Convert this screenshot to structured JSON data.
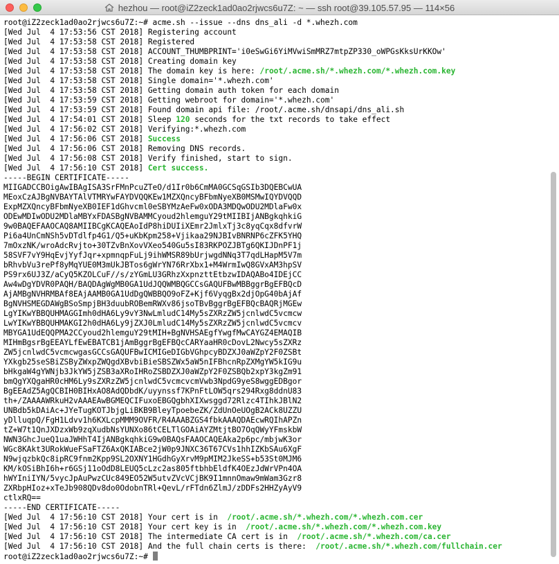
{
  "window": {
    "title": "hezhou — root@iZ2zeck1ad0ao2rjwcs6u7Z: ~ — ssh root@39.105.57.95 — 114×56",
    "home_icon": "home-icon"
  },
  "colors": {
    "highlight": "#2ab532",
    "cursor": "#7f7f7f",
    "text": "#000000"
  },
  "terminal": {
    "prompt_cmd": "root@iZ2zeck1ad0ao2rjwcs6u7Z:~# acme.sh --issue --dns dns_ali -d *.whezh.com",
    "log1": [
      {
        "time": "[Wed Jul  4 17:53:56 CST 2018] ",
        "msg": "Registering account",
        "hl": ""
      },
      {
        "time": "[Wed Jul  4 17:53:58 CST 2018] ",
        "msg": "Registered",
        "hl": ""
      },
      {
        "time": "[Wed Jul  4 17:53:58 CST 2018] ",
        "msg": "ACCOUNT_THUMBPRINT='i0eSwGi6YiMVwiSmMRZ7mtpZP330_oWPGsKksUrKKOw'",
        "hl": ""
      },
      {
        "time": "[Wed Jul  4 17:53:58 CST 2018] ",
        "msg": "Creating domain key",
        "hl": ""
      },
      {
        "time": "[Wed Jul  4 17:53:58 CST 2018] ",
        "msg": "The domain key is here: ",
        "hl": "/root/.acme.sh/*.whezh.com/*.whezh.com.key"
      },
      {
        "time": "[Wed Jul  4 17:53:58 CST 2018] ",
        "msg": "Single domain='*.whezh.com'",
        "hl": ""
      },
      {
        "time": "[Wed Jul  4 17:53:58 CST 2018] ",
        "msg": "Getting domain auth token for each domain",
        "hl": ""
      },
      {
        "time": "[Wed Jul  4 17:53:59 CST 2018] ",
        "msg": "Getting webroot for domain='*.whezh.com'",
        "hl": ""
      },
      {
        "time": "[Wed Jul  4 17:53:59 CST 2018] ",
        "msg": "Found domain api file: /root/.acme.sh/dnsapi/dns_ali.sh",
        "hl": ""
      }
    ],
    "sleep_line": {
      "time": "[Wed Jul  4 17:54:01 CST 2018] ",
      "pre": "Sleep ",
      "hl": "120",
      "post": " seconds for the txt records to take effect"
    },
    "log2": [
      {
        "time": "[Wed Jul  4 17:56:02 CST 2018] ",
        "msg": "Verifying:*.whezh.com",
        "hl": ""
      },
      {
        "time": "[Wed Jul  4 17:56:06 CST 2018] ",
        "msg": "",
        "hl": "Success"
      },
      {
        "time": "[Wed Jul  4 17:56:06 CST 2018] ",
        "msg": "Removing DNS records.",
        "hl": ""
      },
      {
        "time": "[Wed Jul  4 17:56:08 CST 2018] ",
        "msg": "Verify finished, start to sign.",
        "hl": ""
      },
      {
        "time": "[Wed Jul  4 17:56:10 CST 2018] ",
        "msg": "",
        "hl": "Cert success."
      }
    ],
    "certificate": [
      "-----BEGIN CERTIFICATE-----",
      "MIIGADCCBOigAwIBAgISA3SrFMnPcuZTeO/d1Ir0b6CmMA0GCSqGSIb3DQEBCwUA",
      "MEoxCzAJBgNVBAYTAlVTMRYwFAYDVQQKEw1MZXQncyBFbmNyeXB0MSMwIQYDVQQD",
      "ExpMZXQncyBFbmNyeXB0IEF1dGhvcml0eSBYMzAeFw0xODA3MDQwODU2MDlaFw0x",
      "ODEwMDIwODU2MDlaMBYxFDASBgNVBAMMCyoud2hlemguY29tMIIBIjANBgkqhkiG",
      "9w0BAQEFAAOCAQ8AMIIBCgKCAQEAoIdP8hiDUIiXEmr2JmlxTj3c8yqCqx8dfvrW",
      "Pi6a4UnCmNSh5vDTdlfp4G1/Q5+uKbKpm258+Vjikaa29NJBIvBNRNP6cZFK5YHQ",
      "7mOxzNK/wroAdcRvjto+30TZvBnXovVXeo540Gu5sI83RKPOZJBTg6QKIJDnPF1j",
      "58SVF7vY9HqEvjYyfJqr+xpmnqpFuLj9ihWMSR89bUrjwgdNNq3T7qdLHapM5V7m",
      "bRhvbVu3rePf8yMqYUE0M3mUkJBTos6gWrYN76RrXbx1+M4WrmIwQ8GVxAM3hpSV",
      "PS9rx6UJ3Z/aCyQ5KZOLCuF//s/zYGmLU3GRhzXxpnzttEtbzwIDAQABo4IDEjCC",
      "Aw4wDgYDVR0PAQH/BAQDAgWgMB0GA1UdJQQWMBQGCCsGAQUFBwMBBggrBgEFBQcD",
      "AjAMBgNVHRMBAf8EAjAAMB0GA1UdDgQWBBQO9oFZ+Kjf6VyqgBx2djOpG40bAjAf",
      "BgNVHSMEGDAWgBSoSmpjBH3duubROBemRWXv86jsoTBvBggrBgEFBQcBAQRjMGEw",
      "LgYIKwYBBQUHMAGGImh0dHA6Ly9vY3NwLmludC14My5sZXRzZW5jcnlwdC5vcmcw",
      "LwYIKwYBBQUHMAKGI2h0dHA6Ly9jZXJ0LmludC14My5sZXRzZW5jcnlwdC5vcmcv",
      "MBYGA1UdEQQPMA2CCyoud2hlemguY29tMIH+BgNVHSAEgfYwgfMwCAYGZ4EMAQIB",
      "MIHmBgsrBgEEAYLfEwEBATCB1jAmBggrBgEFBQcCARYaaHR0cDovL2Nwcy5sZXRz",
      "ZW5jcnlwdC5vcmcwgasGCCsGAQUFBwICMIGeDIGbVGhpcyBDZXJ0aWZpY2F0ZSBt",
      "YXkgb25seSBiZSByZWxpZWQgdXBvbiBieSBSZWx5aW5nIFBhcnRpZXMgYW5kIG9u",
      "bHkgaW4gYWNjb3JkYW5jZSB3aXRoIHRoZSBDZXJ0aWZpY2F0ZSBQb2xpY3kgZm91",
      "bmQgYXQgaHR0cHM6Ly9sZXRzZW5jcnlwdC5vcmcvcmVwb3NpdG9yeS8wggEDBgor",
      "BgEEAdZ5AgQCBIH0BIHxAO8AdQDbdK/uyynssf7KPnFtLOW5qrs294Rxg8ddnU83",
      "th+/ZAAAAWRkuH2vAAAEAwBGMEQCIFuxoEBGQgbhXIXwsggd72Rlzc4TIhkJBlN2",
      "UNBdb5kDAiAc+JYeTugKOTJbjgLiBKB9BleyTpoebeZK/ZdUnOeUOgB2ACk8UZZU",
      "yDlluqpQ/FgH1Ldvv1h6KXLcpMMM9OVFR/R4AAABZGS4fbkAAAQDAEcwRQIhAPZn",
      "tZ+W7t1QnJXDzxWb9zqXudbNsYUNXo86tCELTlGOAiAYZMtjtBO7OqQWyYFmskbW",
      "NWN3GhcJueQ1uaJWHhT4IjANBgkqhkiG9w0BAQsFAAOCAQEAka2p6pc/mbjwK3or",
      "WGc8KAkt3URokWueFSaFTZ6AxQKIABce2jW0p9JNXC36T67CVs1hhIZKbSAu6XgF",
      "N9wjqzbkQc8ipRC9fnm2Kpp9SL2OXNY1HGdhGyXrvM9pMIM2JkeSS+b53St0MJM6",
      "KM/kOSiBhI6h+r6GSj11oOdD8LEUQ5cLzc2as805ftbhbEldfK4OEzJdWrVPn4OA",
      "hWYIniIYN/5vycJpAuPwzCUc849EO52W5utvZVcVCjBK9I1mnnOmaw9mWam3Gzr8",
      "ZXRbpHIoz+xTeJb908QDv8do0OdobnTRl+QevL/rFTdn6ZlmJ/zDDFs2HHZyAyV9",
      "ctlxRQ==",
      "-----END CERTIFICATE-----"
    ],
    "log3": [
      {
        "time": "[Wed Jul  4 17:56:10 CST 2018] ",
        "msg": "Your cert is in  ",
        "hl": "/root/.acme.sh/*.whezh.com/*.whezh.com.cer"
      },
      {
        "time": "[Wed Jul  4 17:56:10 CST 2018] ",
        "msg": "Your cert key is in  ",
        "hl": "/root/.acme.sh/*.whezh.com/*.whezh.com.key"
      },
      {
        "time": "[Wed Jul  4 17:56:10 CST 2018] ",
        "msg": "The intermediate CA cert is in  ",
        "hl": "/root/.acme.sh/*.whezh.com/ca.cer"
      },
      {
        "time": "[Wed Jul  4 17:56:10 CST 2018] ",
        "msg": "And the full chain certs is there:  ",
        "hl": "/root/.acme.sh/*.whezh.com/fullchain.cer"
      }
    ],
    "final_prompt": "root@iZ2zeck1ad0ao2rjwcs6u7Z:~# "
  }
}
